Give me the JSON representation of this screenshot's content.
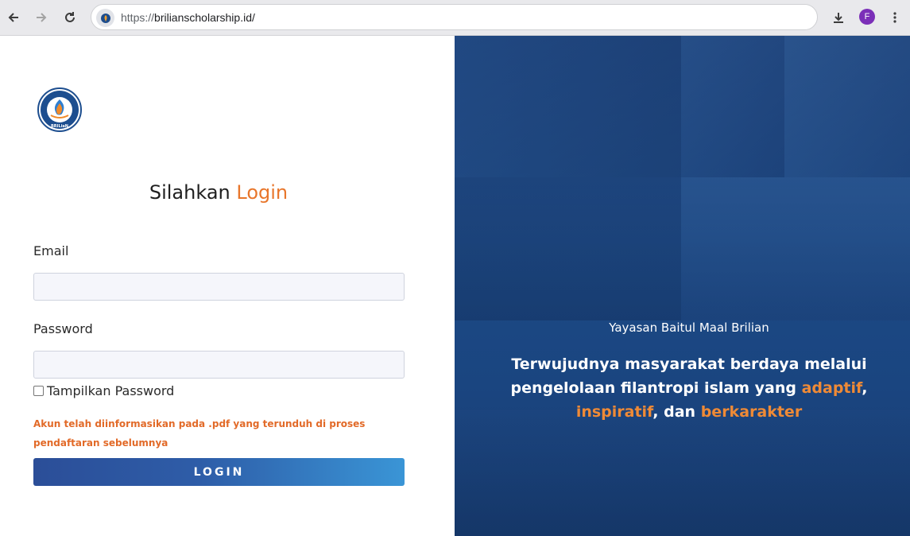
{
  "browser": {
    "url_scheme": "https://",
    "url_host": "brilianscholarship.id/",
    "profile_initial": "F"
  },
  "login": {
    "title_prefix": "Silahkan",
    "title_accent": "Login",
    "email_label": "Email",
    "email_value": "",
    "password_label": "Password",
    "password_value": "",
    "show_password_label": "Tampilkan Password",
    "show_password_checked": false,
    "note": "Akun telah diinformasikan pada .pdf yang terunduh di proses pendaftaran sebelumnya",
    "button_label": "LOGIN"
  },
  "hero": {
    "org_name": "Yayasan Baitul Maal Brilian",
    "tagline_part1": "Terwujudnya masyarakat berdaya melalui pengelolaan filantropi islam yang ",
    "tagline_hl1": "adaptif",
    "tagline_sep1": ", ",
    "tagline_hl2": "inspiratif",
    "tagline_sep2": ", dan ",
    "tagline_hl3": "berkarakter"
  },
  "logo": {
    "text_top": "YAYASAN BAITUL MAAL",
    "text_bottom": "BRILiaN"
  },
  "colors": {
    "accent_orange": "#e8762b",
    "button_start": "#2b4e98",
    "button_end": "#3a95d6",
    "hero_blue": "#1d4a86"
  }
}
